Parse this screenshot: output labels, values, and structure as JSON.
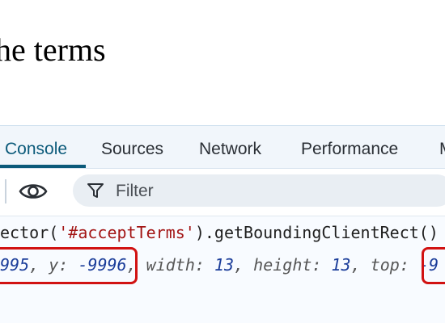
{
  "page": {
    "heading_fragment": "he terms"
  },
  "devtools": {
    "tabs": [
      {
        "label": "Console"
      },
      {
        "label": "Sources"
      },
      {
        "label": "Network"
      },
      {
        "label": "Performance"
      },
      {
        "label": "M"
      }
    ],
    "active_tab": "Console",
    "filter": {
      "placeholder": "Filter"
    },
    "console": {
      "command": {
        "prefix": "ector(",
        "selector": "'#acceptTerms'",
        "suffix": ").getBoundingClientRect()"
      },
      "result": {
        "x_value": "995",
        "y_key": "y",
        "y_value": "-9996",
        "width_key": "width",
        "width_value": "13",
        "height_key": "height",
        "height_value": "13",
        "top_key": "top",
        "top_value": "-9"
      }
    }
  },
  "colors": {
    "active_tab": "#0b5a7a",
    "annotation": "#d11212",
    "number": "#1b3d9a",
    "string": "#a31515"
  },
  "icons": {
    "eye": "eye-icon",
    "filter": "filter-icon"
  }
}
